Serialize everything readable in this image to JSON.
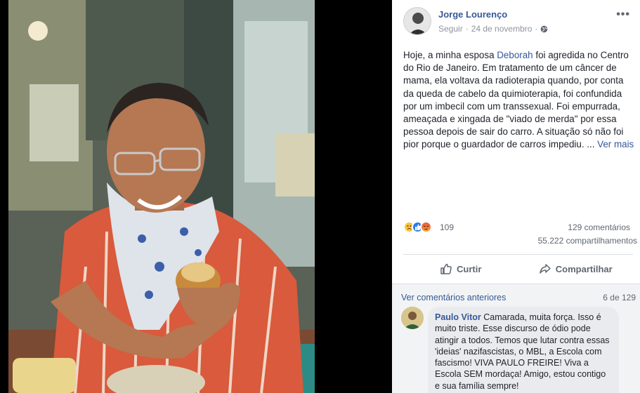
{
  "post": {
    "author": "Jorge Lourenço",
    "follow_label": "Seguir",
    "dot": "·",
    "date": "24 de novembro",
    "dot2": "·",
    "more_label": "•••",
    "text_before": "Hoje, a minha esposa ",
    "mention": "Deborah",
    "text_after": " foi agredida no Centro do Rio de Janeiro. Em tratamento de um câncer de mama, ela voltava da radioterapia quando, por conta da queda de cabelo da quimioterapia, foi confundida por um imbecil com um transsexual. Foi empurrada, ameaçada e xingada de \"viado de merda\" por essa pessoa depois de sair do carro. A situação só não foi pior porque o guardador de carros impediu. ... ",
    "see_more": "Ver mais"
  },
  "stats": {
    "reactions": "109",
    "comments": "129 comentários",
    "shares": "55.222 compartilhamentos"
  },
  "actions": {
    "like": "Curtir",
    "share": "Compartilhar"
  },
  "comments": {
    "previous_label": "Ver comentários anteriores",
    "pager": "6 de 129",
    "items": [
      {
        "name": "Paulo Vitor",
        "text": " Camarada, muita força. Isso é muito triste. Esse discurso de ódio pode atingir a todos. Temos que lutar contra essas 'ideias' nazifascistas, o MBL, a Escola com fascismo! VIVA PAULO FREIRE! Viva a Escola SEM mordaça! Amigo, estou contigo e sua família sempre!"
      }
    ]
  },
  "colors": {
    "link": "#365899",
    "text": "#1d2129",
    "muted": "#606770",
    "like_blue": "#2b7bf2"
  },
  "icons": [
    "more-icon",
    "globe-icon",
    "sad-reaction-icon",
    "like-reaction-icon",
    "angry-reaction-icon",
    "thumbs-up-icon",
    "share-arrow-icon"
  ]
}
